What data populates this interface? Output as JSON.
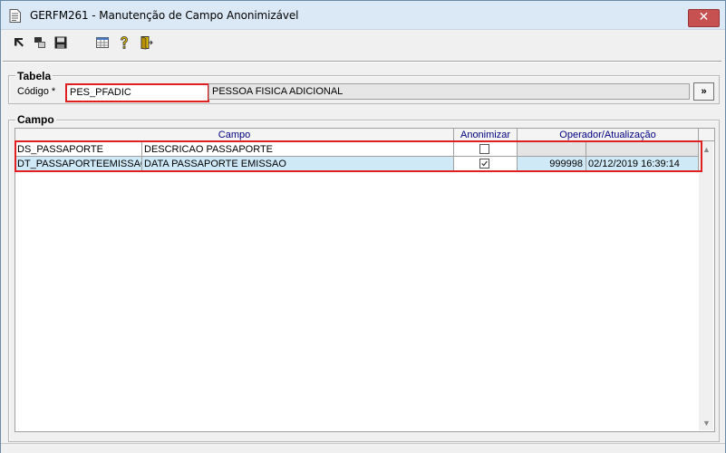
{
  "window": {
    "title": "GERFM261 - Manutenção de Campo Anonimizável",
    "close_label": "✕"
  },
  "toolbar": {
    "buttons": [
      {
        "name": "first-record-icon"
      },
      {
        "name": "copy-record-icon"
      },
      {
        "name": "save-icon"
      },
      {
        "name": "grid-view-icon"
      },
      {
        "name": "help-icon"
      },
      {
        "name": "exit-icon"
      }
    ]
  },
  "tabela": {
    "group_label": "Tabela",
    "codigo_label": "Código *",
    "codigo_value": "PES_PFADIC",
    "descricao_value": "PESSOA FISICA ADICIONAL",
    "lookup_label": "»"
  },
  "campo": {
    "group_label": "Campo",
    "headers": {
      "campo": "Campo",
      "anonimizar": "Anonimizar",
      "operador": "Operador/Atualização"
    },
    "rows": [
      {
        "campo": "DS_PASSAPORTE",
        "descricao": "DESCRICAO PASSAPORTE",
        "anonimizar": false,
        "operador": "",
        "atualizacao": ""
      },
      {
        "campo": "DT_PASSAPORTEEMISSAO",
        "descricao": "DATA PASSAPORTE EMISSAO",
        "anonimizar": true,
        "operador": "999998",
        "atualizacao": "02/12/2019 16:39:14"
      }
    ]
  },
  "colors": {
    "highlight": "#e02020",
    "header_text": "#000080",
    "selected_row": "#cfe9f7",
    "close_button": "#c75050"
  }
}
